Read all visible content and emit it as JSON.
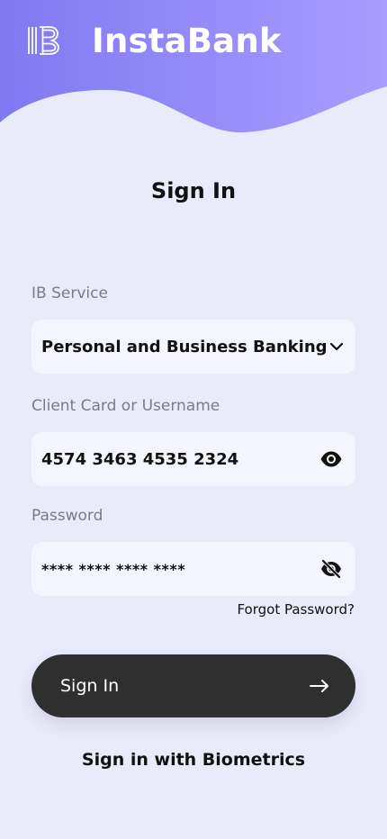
{
  "brand": {
    "name": "InstaBank",
    "logo_icon": "instabank-logo-icon",
    "gradient_start": "#7f79f2",
    "gradient_end": "#a99cff"
  },
  "page": {
    "title": "Sign In",
    "background": "#e9ebfb"
  },
  "form": {
    "service": {
      "label": "IB Service",
      "value": "Personal and Business Banking",
      "icon": "chevron-down-icon"
    },
    "username": {
      "label": "Client Card or Username",
      "value": "4574 3463 4535 2324",
      "icon": "eye-icon"
    },
    "password": {
      "label": "Password",
      "value": "**** **** **** ****",
      "icon": "eye-off-icon"
    },
    "forgot_password": "Forgot Password?"
  },
  "actions": {
    "sign_in": "Sign In",
    "sign_in_icon": "arrow-right-icon",
    "biometrics": "Sign in with Biometrics"
  }
}
